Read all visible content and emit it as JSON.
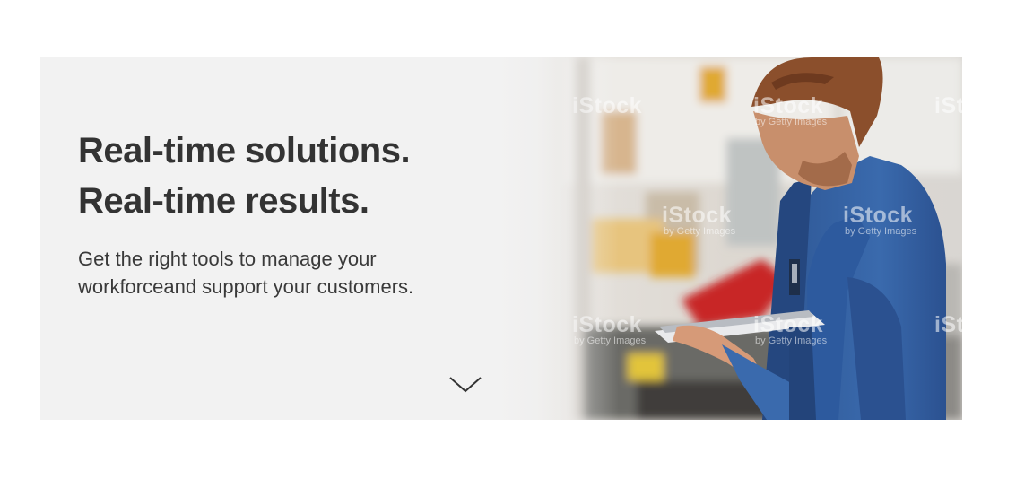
{
  "hero": {
    "headline_line1": "Real-time solutions.",
    "headline_line2": "Real-time results.",
    "subtext": "Get the right tools to manage your workforceand support your customers.",
    "scroll_icon": "chevron-down-icon",
    "background_color": "#f2f2f2",
    "headline_color": "#333333"
  },
  "watermark": {
    "brand": "iStock",
    "byline": "by Getty Images"
  }
}
